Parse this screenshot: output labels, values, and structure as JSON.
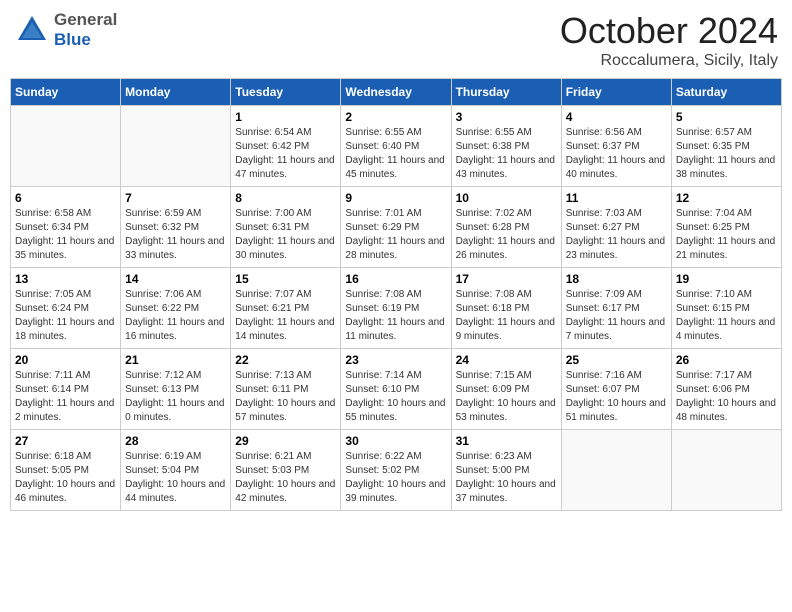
{
  "header": {
    "logo_general": "General",
    "logo_blue": "Blue",
    "month": "October 2024",
    "location": "Roccalumera, Sicily, Italy"
  },
  "weekdays": [
    "Sunday",
    "Monday",
    "Tuesday",
    "Wednesday",
    "Thursday",
    "Friday",
    "Saturday"
  ],
  "weeks": [
    [
      {
        "day": "",
        "detail": ""
      },
      {
        "day": "",
        "detail": ""
      },
      {
        "day": "1",
        "detail": "Sunrise: 6:54 AM\nSunset: 6:42 PM\nDaylight: 11 hours and 47 minutes."
      },
      {
        "day": "2",
        "detail": "Sunrise: 6:55 AM\nSunset: 6:40 PM\nDaylight: 11 hours and 45 minutes."
      },
      {
        "day": "3",
        "detail": "Sunrise: 6:55 AM\nSunset: 6:38 PM\nDaylight: 11 hours and 43 minutes."
      },
      {
        "day": "4",
        "detail": "Sunrise: 6:56 AM\nSunset: 6:37 PM\nDaylight: 11 hours and 40 minutes."
      },
      {
        "day": "5",
        "detail": "Sunrise: 6:57 AM\nSunset: 6:35 PM\nDaylight: 11 hours and 38 minutes."
      }
    ],
    [
      {
        "day": "6",
        "detail": "Sunrise: 6:58 AM\nSunset: 6:34 PM\nDaylight: 11 hours and 35 minutes."
      },
      {
        "day": "7",
        "detail": "Sunrise: 6:59 AM\nSunset: 6:32 PM\nDaylight: 11 hours and 33 minutes."
      },
      {
        "day": "8",
        "detail": "Sunrise: 7:00 AM\nSunset: 6:31 PM\nDaylight: 11 hours and 30 minutes."
      },
      {
        "day": "9",
        "detail": "Sunrise: 7:01 AM\nSunset: 6:29 PM\nDaylight: 11 hours and 28 minutes."
      },
      {
        "day": "10",
        "detail": "Sunrise: 7:02 AM\nSunset: 6:28 PM\nDaylight: 11 hours and 26 minutes."
      },
      {
        "day": "11",
        "detail": "Sunrise: 7:03 AM\nSunset: 6:27 PM\nDaylight: 11 hours and 23 minutes."
      },
      {
        "day": "12",
        "detail": "Sunrise: 7:04 AM\nSunset: 6:25 PM\nDaylight: 11 hours and 21 minutes."
      }
    ],
    [
      {
        "day": "13",
        "detail": "Sunrise: 7:05 AM\nSunset: 6:24 PM\nDaylight: 11 hours and 18 minutes."
      },
      {
        "day": "14",
        "detail": "Sunrise: 7:06 AM\nSunset: 6:22 PM\nDaylight: 11 hours and 16 minutes."
      },
      {
        "day": "15",
        "detail": "Sunrise: 7:07 AM\nSunset: 6:21 PM\nDaylight: 11 hours and 14 minutes."
      },
      {
        "day": "16",
        "detail": "Sunrise: 7:08 AM\nSunset: 6:19 PM\nDaylight: 11 hours and 11 minutes."
      },
      {
        "day": "17",
        "detail": "Sunrise: 7:08 AM\nSunset: 6:18 PM\nDaylight: 11 hours and 9 minutes."
      },
      {
        "day": "18",
        "detail": "Sunrise: 7:09 AM\nSunset: 6:17 PM\nDaylight: 11 hours and 7 minutes."
      },
      {
        "day": "19",
        "detail": "Sunrise: 7:10 AM\nSunset: 6:15 PM\nDaylight: 11 hours and 4 minutes."
      }
    ],
    [
      {
        "day": "20",
        "detail": "Sunrise: 7:11 AM\nSunset: 6:14 PM\nDaylight: 11 hours and 2 minutes."
      },
      {
        "day": "21",
        "detail": "Sunrise: 7:12 AM\nSunset: 6:13 PM\nDaylight: 11 hours and 0 minutes."
      },
      {
        "day": "22",
        "detail": "Sunrise: 7:13 AM\nSunset: 6:11 PM\nDaylight: 10 hours and 57 minutes."
      },
      {
        "day": "23",
        "detail": "Sunrise: 7:14 AM\nSunset: 6:10 PM\nDaylight: 10 hours and 55 minutes."
      },
      {
        "day": "24",
        "detail": "Sunrise: 7:15 AM\nSunset: 6:09 PM\nDaylight: 10 hours and 53 minutes."
      },
      {
        "day": "25",
        "detail": "Sunrise: 7:16 AM\nSunset: 6:07 PM\nDaylight: 10 hours and 51 minutes."
      },
      {
        "day": "26",
        "detail": "Sunrise: 7:17 AM\nSunset: 6:06 PM\nDaylight: 10 hours and 48 minutes."
      }
    ],
    [
      {
        "day": "27",
        "detail": "Sunrise: 6:18 AM\nSunset: 5:05 PM\nDaylight: 10 hours and 46 minutes."
      },
      {
        "day": "28",
        "detail": "Sunrise: 6:19 AM\nSunset: 5:04 PM\nDaylight: 10 hours and 44 minutes."
      },
      {
        "day": "29",
        "detail": "Sunrise: 6:21 AM\nSunset: 5:03 PM\nDaylight: 10 hours and 42 minutes."
      },
      {
        "day": "30",
        "detail": "Sunrise: 6:22 AM\nSunset: 5:02 PM\nDaylight: 10 hours and 39 minutes."
      },
      {
        "day": "31",
        "detail": "Sunrise: 6:23 AM\nSunset: 5:00 PM\nDaylight: 10 hours and 37 minutes."
      },
      {
        "day": "",
        "detail": ""
      },
      {
        "day": "",
        "detail": ""
      }
    ]
  ]
}
